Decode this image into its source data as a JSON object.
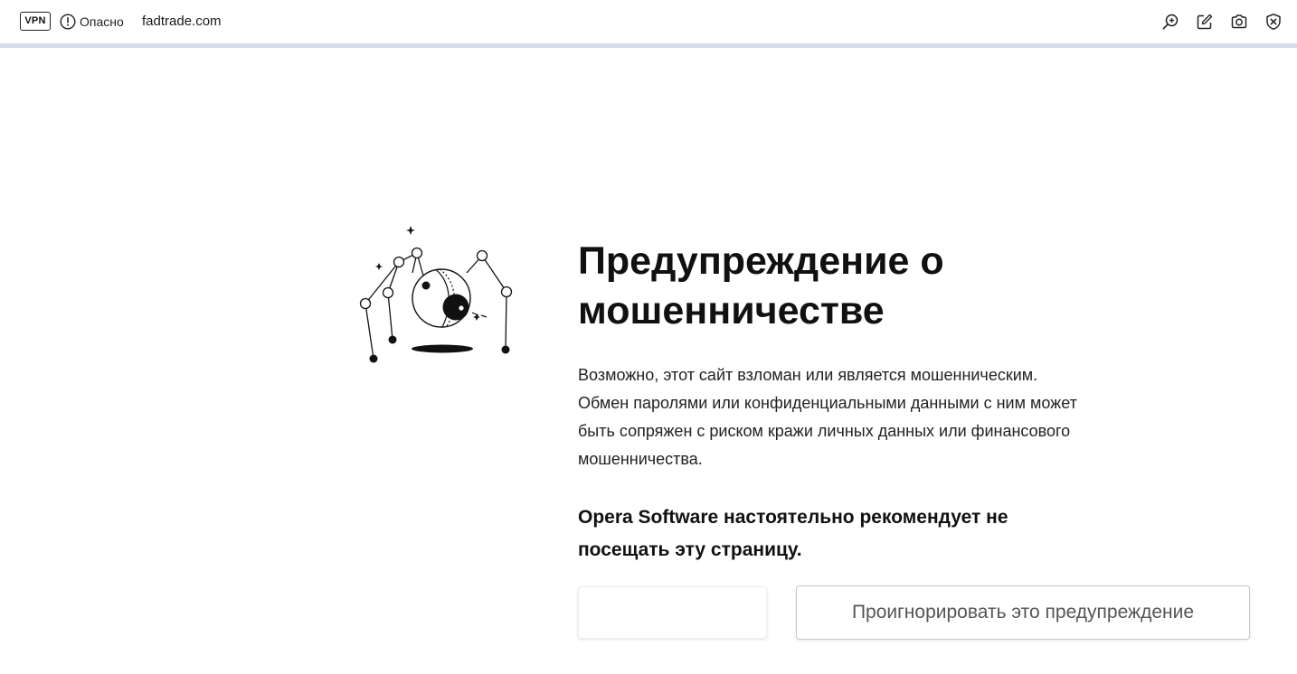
{
  "addressbar": {
    "vpn_label": "VPN",
    "security_label": "Опасно",
    "url": "fadtrade.com",
    "icons": [
      "zoom-in-icon",
      "edit-icon",
      "camera-icon",
      "shield-close-icon"
    ]
  },
  "warning": {
    "title": "Предупреждение о мошенничестве",
    "description": "Возможно, этот сайт взломан или является мошенническим. Обмен паролями или конфиденциальными данными с ним может быть сопряжен с риском кражи личных данных или финансового мошенничества.",
    "recommendation": "Opera Software настоятельно рекомендует не посещать эту страницу."
  },
  "buttons": {
    "back_label": "",
    "ignore_label": "Проигнорировать это предупреждение"
  },
  "colors": {
    "underline": "#d4dee8",
    "text": "#111111"
  }
}
